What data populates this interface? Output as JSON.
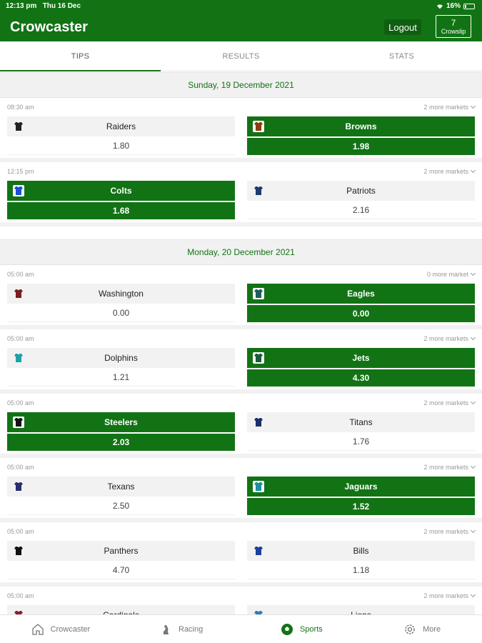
{
  "status": {
    "time": "12:13 pm",
    "date": "Thu 16 Dec",
    "battery": "16%"
  },
  "header": {
    "title": "Crowcaster",
    "logout_label": "Logout",
    "crowslip_count": "7",
    "crowslip_label": "Crowslip"
  },
  "tabs": [
    {
      "label": "TIPS",
      "active": true
    },
    {
      "label": "RESULTS",
      "active": false
    },
    {
      "label": "STATS",
      "active": false
    }
  ],
  "days": [
    {
      "date": "Sunday, 19 December 2021",
      "matches": [
        {
          "time": "08:30 am",
          "more": "2 more markets",
          "home": {
            "name": "Raiders",
            "odds": "1.80",
            "selected": false,
            "jersey": "raiders-jersey-icon",
            "color": "#222222"
          },
          "away": {
            "name": "Browns",
            "odds": "1.98",
            "selected": true,
            "jersey": "browns-jersey-icon",
            "color": "#8a3b12"
          }
        },
        {
          "time": "12:15 pm",
          "more": "2 more markets",
          "home": {
            "name": "Colts",
            "odds": "1.68",
            "selected": true,
            "jersey": "colts-jersey-icon",
            "color": "#1d4ed8"
          },
          "away": {
            "name": "Patriots",
            "odds": "2.16",
            "selected": false,
            "jersey": "patriots-jersey-icon",
            "color": "#1e3a6e"
          }
        }
      ]
    },
    {
      "date": "Monday, 20 December 2021",
      "matches": [
        {
          "time": "05:00 am",
          "more": "0 more market",
          "home": {
            "name": "Washington",
            "odds": "0.00",
            "selected": false,
            "jersey": "washington-jersey-icon",
            "color": "#7a1f1f"
          },
          "away": {
            "name": "Eagles",
            "odds": "0.00",
            "selected": true,
            "jersey": "eagles-jersey-icon",
            "color": "#1f5d5a"
          }
        },
        {
          "time": "05:00 am",
          "more": "2 more markets",
          "home": {
            "name": "Dolphins",
            "odds": "1.21",
            "selected": false,
            "jersey": "dolphins-jersey-icon",
            "color": "#1fa0a8"
          },
          "away": {
            "name": "Jets",
            "odds": "4.30",
            "selected": true,
            "jersey": "jets-jersey-icon",
            "color": "#1c5a3a"
          }
        },
        {
          "time": "05:00 am",
          "more": "2 more markets",
          "home": {
            "name": "Steelers",
            "odds": "2.03",
            "selected": true,
            "jersey": "steelers-jersey-icon",
            "color": "#111111"
          },
          "away": {
            "name": "Titans",
            "odds": "1.76",
            "selected": false,
            "jersey": "titans-jersey-icon",
            "color": "#1a2f6b"
          }
        },
        {
          "time": "05:00 am",
          "more": "2 more markets",
          "home": {
            "name": "Texans",
            "odds": "2.50",
            "selected": false,
            "jersey": "texans-jersey-icon",
            "color": "#2a2f6e"
          },
          "away": {
            "name": "Jaguars",
            "odds": "1.52",
            "selected": true,
            "jersey": "jaguars-jersey-icon",
            "color": "#1c8fa0"
          }
        },
        {
          "time": "05:00 am",
          "more": "2 more markets",
          "home": {
            "name": "Panthers",
            "odds": "4.70",
            "selected": false,
            "jersey": "panthers-jersey-icon",
            "color": "#111111"
          },
          "away": {
            "name": "Bills",
            "odds": "1.18",
            "selected": false,
            "jersey": "bills-jersey-icon",
            "color": "#1d3fa0"
          }
        },
        {
          "time": "05:00 am",
          "more": "2 more markets",
          "home": {
            "name": "Cardinals",
            "odds": "",
            "selected": false,
            "jersey": "cardinals-jersey-icon",
            "color": "#8a1f2f"
          },
          "away": {
            "name": "Lions",
            "odds": "",
            "selected": false,
            "jersey": "lions-jersey-icon",
            "color": "#2a7fc0"
          }
        }
      ]
    }
  ],
  "nav": [
    {
      "label": "Crowcaster",
      "icon": "home-icon",
      "active": false
    },
    {
      "label": "Racing",
      "icon": "racing-icon",
      "active": false
    },
    {
      "label": "Sports",
      "icon": "soccer-ball-icon",
      "active": true
    },
    {
      "label": "More",
      "icon": "gear-icon",
      "active": false
    }
  ]
}
